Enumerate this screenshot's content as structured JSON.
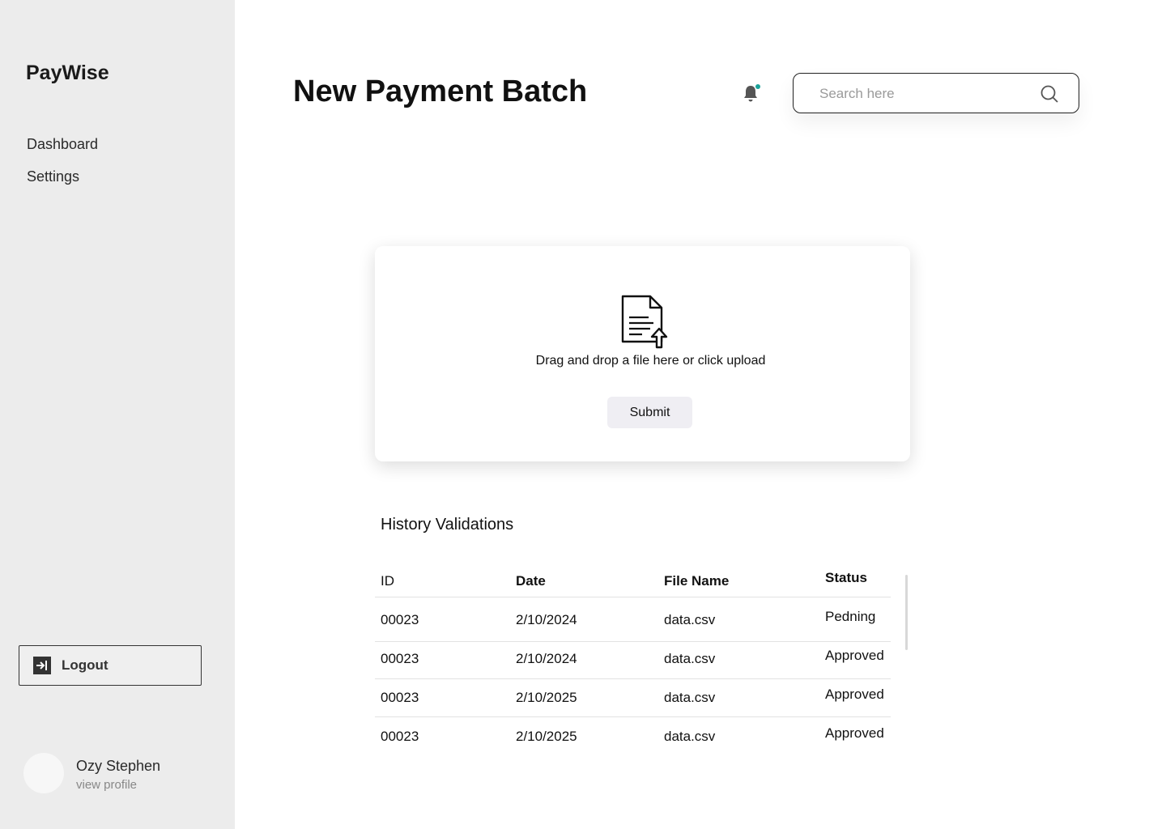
{
  "sidebar": {
    "brand": "PayWise",
    "nav": [
      "Dashboard",
      "Settings"
    ],
    "logout_label": "Logout",
    "user": {
      "name": "Ozy Stephen",
      "link": "view profile"
    }
  },
  "header": {
    "title": "New Payment Batch",
    "search_placeholder": "Search here",
    "notification_dot_color": "#1aa39a"
  },
  "upload": {
    "instruction": "Drag and drop a file here or click upload",
    "submit_label": "Submit"
  },
  "history": {
    "title": "History Validations",
    "columns": [
      "ID",
      "Date",
      "File Name",
      "Status"
    ],
    "rows": [
      [
        "00023",
        "2/10/2024",
        "data.csv",
        "Pedning"
      ],
      [
        "00023",
        "2/10/2024",
        "data.csv",
        "Approved"
      ],
      [
        "00023",
        "2/10/2025",
        "data.csv",
        "Approved"
      ],
      [
        "00023",
        "2/10/2025",
        "data.csv",
        "Approved"
      ]
    ]
  }
}
